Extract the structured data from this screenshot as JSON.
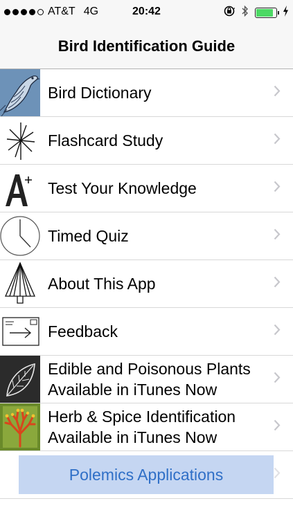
{
  "status_bar": {
    "carrier": "AT&T",
    "network": "4G",
    "time": "20:42",
    "battery_level": 0.92,
    "battery_color": "#4cd964",
    "icons": [
      "orientation-lock-icon",
      "bluetooth-icon",
      "battery-icon",
      "charging-icon"
    ]
  },
  "nav": {
    "title": "Bird Identification Guide"
  },
  "menu": {
    "items": [
      {
        "label": "Bird Dictionary",
        "icon": "bird-sketch-icon"
      },
      {
        "label": "Flashcard Study",
        "icon": "starburst-icon"
      },
      {
        "label": "Test Your Knowledge",
        "icon": "a-plus-icon"
      },
      {
        "label": "Timed Quiz",
        "icon": "clock-icon"
      },
      {
        "label": "About This App",
        "icon": "pyramid-tree-icon"
      },
      {
        "label": "Feedback",
        "icon": "envelope-arrow-icon"
      },
      {
        "label": "Edible and Poisonous Plants\nAvailable in iTunes Now",
        "line1": "Edible and Poisonous Plants",
        "line2": "Available in iTunes Now",
        "icon": "leaf-icon"
      },
      {
        "label": "Herb & Spice Identification\nAvailable in iTunes Now",
        "line1": "Herb & Spice Identification",
        "line2": "Available in iTunes Now",
        "icon": "coral-herb-icon"
      }
    ],
    "button_label": "Polemics Applications"
  },
  "colors": {
    "accent_text": "#2f6fc7",
    "button_bg": "#c5d6f2",
    "chevron": "#c7c7cc"
  }
}
